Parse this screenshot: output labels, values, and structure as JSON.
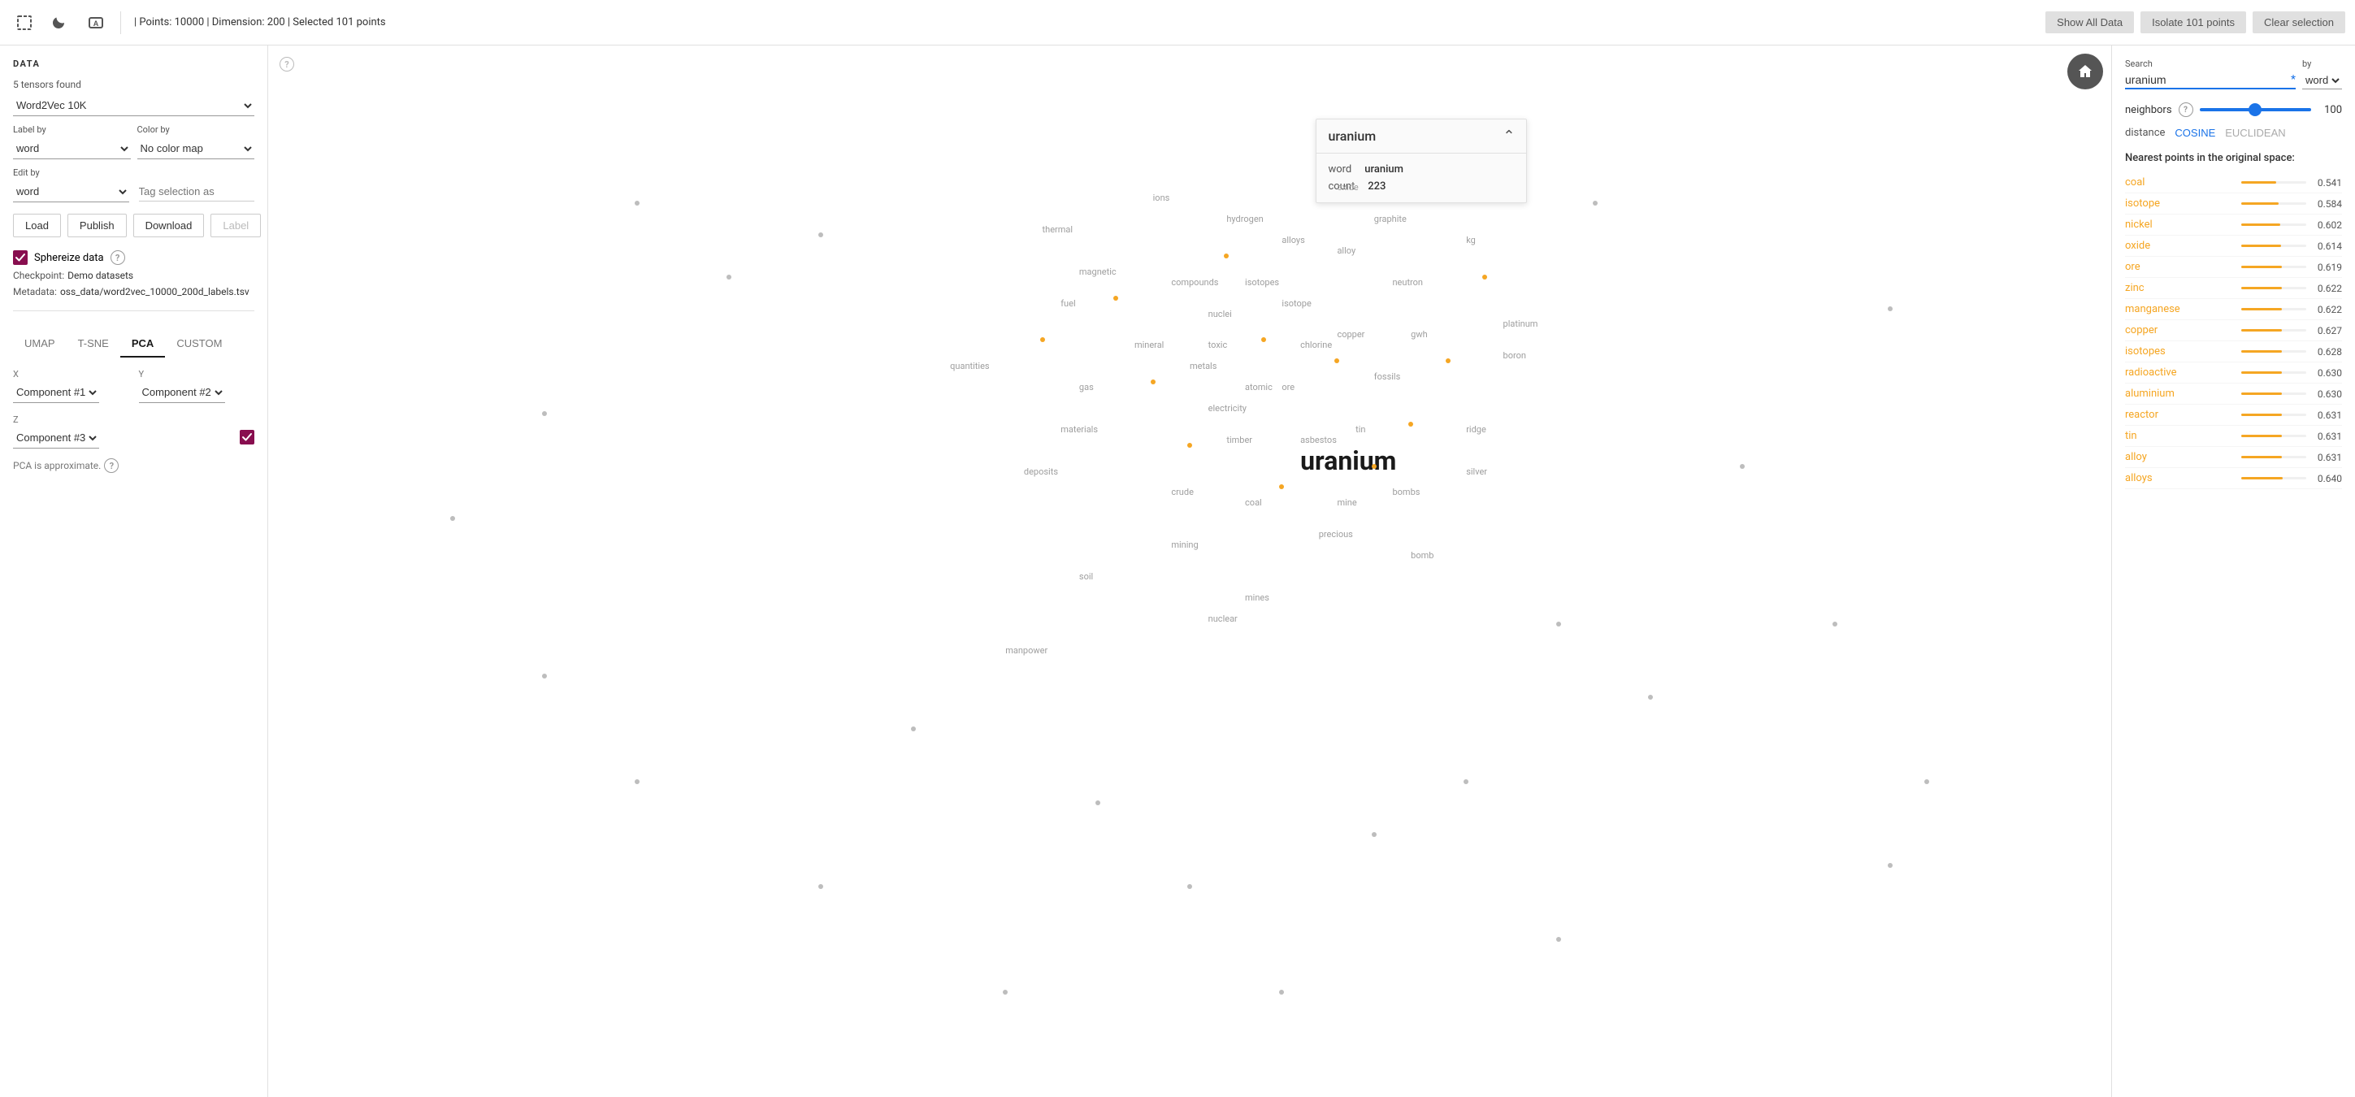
{
  "app": {
    "title": "DATA"
  },
  "topbar": {
    "points_info": "| Points: 10000 | Dimension: 200 | Selected 101 points",
    "show_all_btn": "Show All Data",
    "isolate_btn": "Isolate 101 points",
    "clear_btn": "Clear selection"
  },
  "sidebar": {
    "tensors_found": "5 tensors found",
    "dataset_value": "Word2Vec 10K",
    "label_by_label": "Label by",
    "label_by_value": "word",
    "color_by_label": "Color by",
    "color_by_value": "No color map",
    "edit_by_label": "Edit by",
    "edit_by_value": "word",
    "tag_placeholder": "Tag selection as",
    "load_btn": "Load",
    "publish_btn": "Publish",
    "download_btn": "Download",
    "label_btn": "Label",
    "sphereize_label": "Sphereize data",
    "checkpoint_label": "Checkpoint:",
    "checkpoint_value": "Demo datasets",
    "metadata_label": "Metadata:",
    "metadata_value": "oss_data/word2vec_10000_200d_labels.tsv",
    "proj_tabs": [
      "UMAP",
      "T-SNE",
      "PCA",
      "CUSTOM"
    ],
    "active_tab": "PCA",
    "x_label": "X",
    "x_value": "Component #1",
    "y_label": "Y",
    "y_value": "Component #2",
    "z_label": "Z",
    "z_value": "Component #3",
    "pca_note": "PCA is approximate."
  },
  "infobox": {
    "title": "uranium",
    "word_label": "word",
    "word_value": "uranium",
    "count_label": "count",
    "count_value": "223"
  },
  "right_panel": {
    "search_label": "Search",
    "search_value": "uranium",
    "search_asterisk": "*",
    "by_label": "by",
    "by_value": "word",
    "neighbors_label": "neighbors",
    "neighbors_value": "100",
    "distance_label": "distance",
    "cosine_label": "COSINE",
    "euclidean_label": "EUCLIDEAN",
    "nearest_title": "Nearest points in the original space:",
    "nearest_items": [
      {
        "name": "coal",
        "value": "0.541",
        "pct": 54
      },
      {
        "name": "isotope",
        "value": "0.584",
        "pct": 58
      },
      {
        "name": "nickel",
        "value": "0.602",
        "pct": 60
      },
      {
        "name": "oxide",
        "value": "0.614",
        "pct": 61
      },
      {
        "name": "ore",
        "value": "0.619",
        "pct": 62
      },
      {
        "name": "zinc",
        "value": "0.622",
        "pct": 62
      },
      {
        "name": "manganese",
        "value": "0.622",
        "pct": 62
      },
      {
        "name": "copper",
        "value": "0.627",
        "pct": 63
      },
      {
        "name": "isotopes",
        "value": "0.628",
        "pct": 63
      },
      {
        "name": "radioactive",
        "value": "0.630",
        "pct": 63
      },
      {
        "name": "aluminium",
        "value": "0.630",
        "pct": 63
      },
      {
        "name": "reactor",
        "value": "0.631",
        "pct": 63
      },
      {
        "name": "tin",
        "value": "0.631",
        "pct": 63
      },
      {
        "name": "alloy",
        "value": "0.631",
        "pct": 63
      },
      {
        "name": "alloys",
        "value": "0.640",
        "pct": 64
      }
    ]
  },
  "scatter": {
    "words": [
      {
        "text": "ions",
        "x": 48,
        "y": 14,
        "size": "sm"
      },
      {
        "text": "oxide",
        "x": 58,
        "y": 13,
        "size": "sm"
      },
      {
        "text": "thermal",
        "x": 42,
        "y": 17,
        "size": "sm"
      },
      {
        "text": "hydrogen",
        "x": 52,
        "y": 16,
        "size": "sm"
      },
      {
        "text": "graphite",
        "x": 60,
        "y": 16,
        "size": "sm"
      },
      {
        "text": "magnetic",
        "x": 44,
        "y": 21,
        "size": "sm"
      },
      {
        "text": "alloys",
        "x": 55,
        "y": 18,
        "size": "sm"
      },
      {
        "text": "alloy",
        "x": 58,
        "y": 19,
        "size": "sm"
      },
      {
        "text": "kg",
        "x": 65,
        "y": 18,
        "size": "sm"
      },
      {
        "text": "fuel",
        "x": 43,
        "y": 24,
        "size": "sm"
      },
      {
        "text": "compounds",
        "x": 49,
        "y": 22,
        "size": "sm"
      },
      {
        "text": "isotopes",
        "x": 53,
        "y": 22,
        "size": "sm"
      },
      {
        "text": "nuclei",
        "x": 51,
        "y": 25,
        "size": "sm"
      },
      {
        "text": "isotope",
        "x": 55,
        "y": 24,
        "size": "sm"
      },
      {
        "text": "neutron",
        "x": 61,
        "y": 22,
        "size": "sm"
      },
      {
        "text": "mineral",
        "x": 47,
        "y": 28,
        "size": "sm"
      },
      {
        "text": "toxic",
        "x": 51,
        "y": 28,
        "size": "sm"
      },
      {
        "text": "chlorine",
        "x": 56,
        "y": 28,
        "size": "sm"
      },
      {
        "text": "copper",
        "x": 58,
        "y": 27,
        "size": "sm"
      },
      {
        "text": "gwh",
        "x": 62,
        "y": 27,
        "size": "sm"
      },
      {
        "text": "platinum",
        "x": 67,
        "y": 26,
        "size": "sm"
      },
      {
        "text": "metals",
        "x": 50,
        "y": 30,
        "size": "sm"
      },
      {
        "text": "boron",
        "x": 67,
        "y": 29,
        "size": "sm"
      },
      {
        "text": "gas",
        "x": 44,
        "y": 32,
        "size": "sm"
      },
      {
        "text": "atomic",
        "x": 53,
        "y": 32,
        "size": "sm"
      },
      {
        "text": "ore",
        "x": 55,
        "y": 32,
        "size": "sm"
      },
      {
        "text": "fossils",
        "x": 60,
        "y": 31,
        "size": "sm"
      },
      {
        "text": "electricity",
        "x": 51,
        "y": 34,
        "size": "sm"
      },
      {
        "text": "quantities",
        "x": 37,
        "y": 30,
        "size": "sm"
      },
      {
        "text": "materials",
        "x": 43,
        "y": 36,
        "size": "sm"
      },
      {
        "text": "timber",
        "x": 52,
        "y": 37,
        "size": "sm"
      },
      {
        "text": "asbestos",
        "x": 56,
        "y": 37,
        "size": "sm"
      },
      {
        "text": "tin",
        "x": 59,
        "y": 36,
        "size": "sm"
      },
      {
        "text": "ridge",
        "x": 65,
        "y": 36,
        "size": "sm"
      },
      {
        "text": "uranium",
        "x": 56,
        "y": 38,
        "size": "xl"
      },
      {
        "text": "silver",
        "x": 65,
        "y": 40,
        "size": "sm"
      },
      {
        "text": "deposits",
        "x": 41,
        "y": 40,
        "size": "sm"
      },
      {
        "text": "crude",
        "x": 49,
        "y": 42,
        "size": "sm"
      },
      {
        "text": "coal",
        "x": 53,
        "y": 43,
        "size": "sm"
      },
      {
        "text": "mine",
        "x": 58,
        "y": 43,
        "size": "sm"
      },
      {
        "text": "bombs",
        "x": 61,
        "y": 42,
        "size": "sm"
      },
      {
        "text": "mining",
        "x": 49,
        "y": 47,
        "size": "sm"
      },
      {
        "text": "precious",
        "x": 57,
        "y": 46,
        "size": "sm"
      },
      {
        "text": "bomb",
        "x": 62,
        "y": 48,
        "size": "sm"
      },
      {
        "text": "soil",
        "x": 44,
        "y": 50,
        "size": "sm"
      },
      {
        "text": "mines",
        "x": 53,
        "y": 52,
        "size": "sm"
      },
      {
        "text": "nuclear",
        "x": 51,
        "y": 54,
        "size": "sm"
      },
      {
        "text": "manpower",
        "x": 40,
        "y": 57,
        "size": "sm"
      }
    ]
  }
}
